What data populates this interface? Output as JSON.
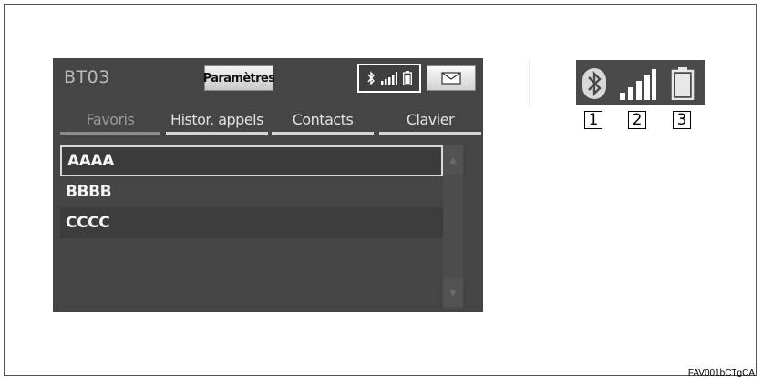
{
  "screen": {
    "device_name": "BT03",
    "settings_label": "Paramètres",
    "tabs": [
      {
        "label": "Favoris",
        "active": true
      },
      {
        "label": "Histor. appels",
        "active": false
      },
      {
        "label": "Contacts",
        "active": false
      },
      {
        "label": "Clavier",
        "active": false
      }
    ],
    "contacts": [
      "AAAA",
      "BBBB",
      "CCCC"
    ],
    "status_icons": [
      "bluetooth-icon",
      "signal-strength-icon",
      "battery-icon"
    ],
    "message_icon": "envelope-icon"
  },
  "legend": {
    "icons": [
      "bluetooth-icon",
      "signal-strength-icon",
      "battery-icon"
    ],
    "numbers": [
      "1",
      "2",
      "3"
    ]
  },
  "figure_code": "FAV001bCTgCA"
}
